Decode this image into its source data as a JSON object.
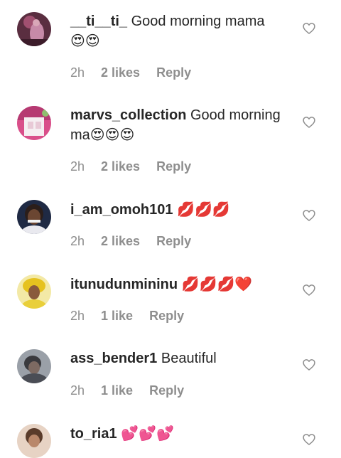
{
  "comments": [
    {
      "username": "__ti__ti_",
      "text": "Good morning mama",
      "emoji": "😍😍",
      "time": "2h",
      "likes": "2 likes",
      "reply": "Reply"
    },
    {
      "username": "marvs_collection",
      "text": "Good morning ma",
      "emoji": "😍😍😍",
      "time": "2h",
      "likes": "2 likes",
      "reply": "Reply"
    },
    {
      "username": "i_am_omoh101",
      "text": "",
      "emoji": "💋💋💋",
      "time": "2h",
      "likes": "2 likes",
      "reply": "Reply"
    },
    {
      "username": "itunudunmininu",
      "text": "",
      "emoji": "💋💋💋❤️",
      "time": "2h",
      "likes": "1 like",
      "reply": "Reply"
    },
    {
      "username": "ass_bender1",
      "text": "Beautiful",
      "emoji": "",
      "time": "2h",
      "likes": "1 like",
      "reply": "Reply"
    },
    {
      "username": "to_ria1",
      "text": "",
      "emoji": "💕💕💕",
      "time": "",
      "likes": "",
      "reply": ""
    }
  ],
  "icons": {
    "like": "heart-outline-icon"
  },
  "colors": {
    "text": "#262626",
    "secondary": "#8e8e8e",
    "heart_stroke": "#8e8e8e"
  }
}
